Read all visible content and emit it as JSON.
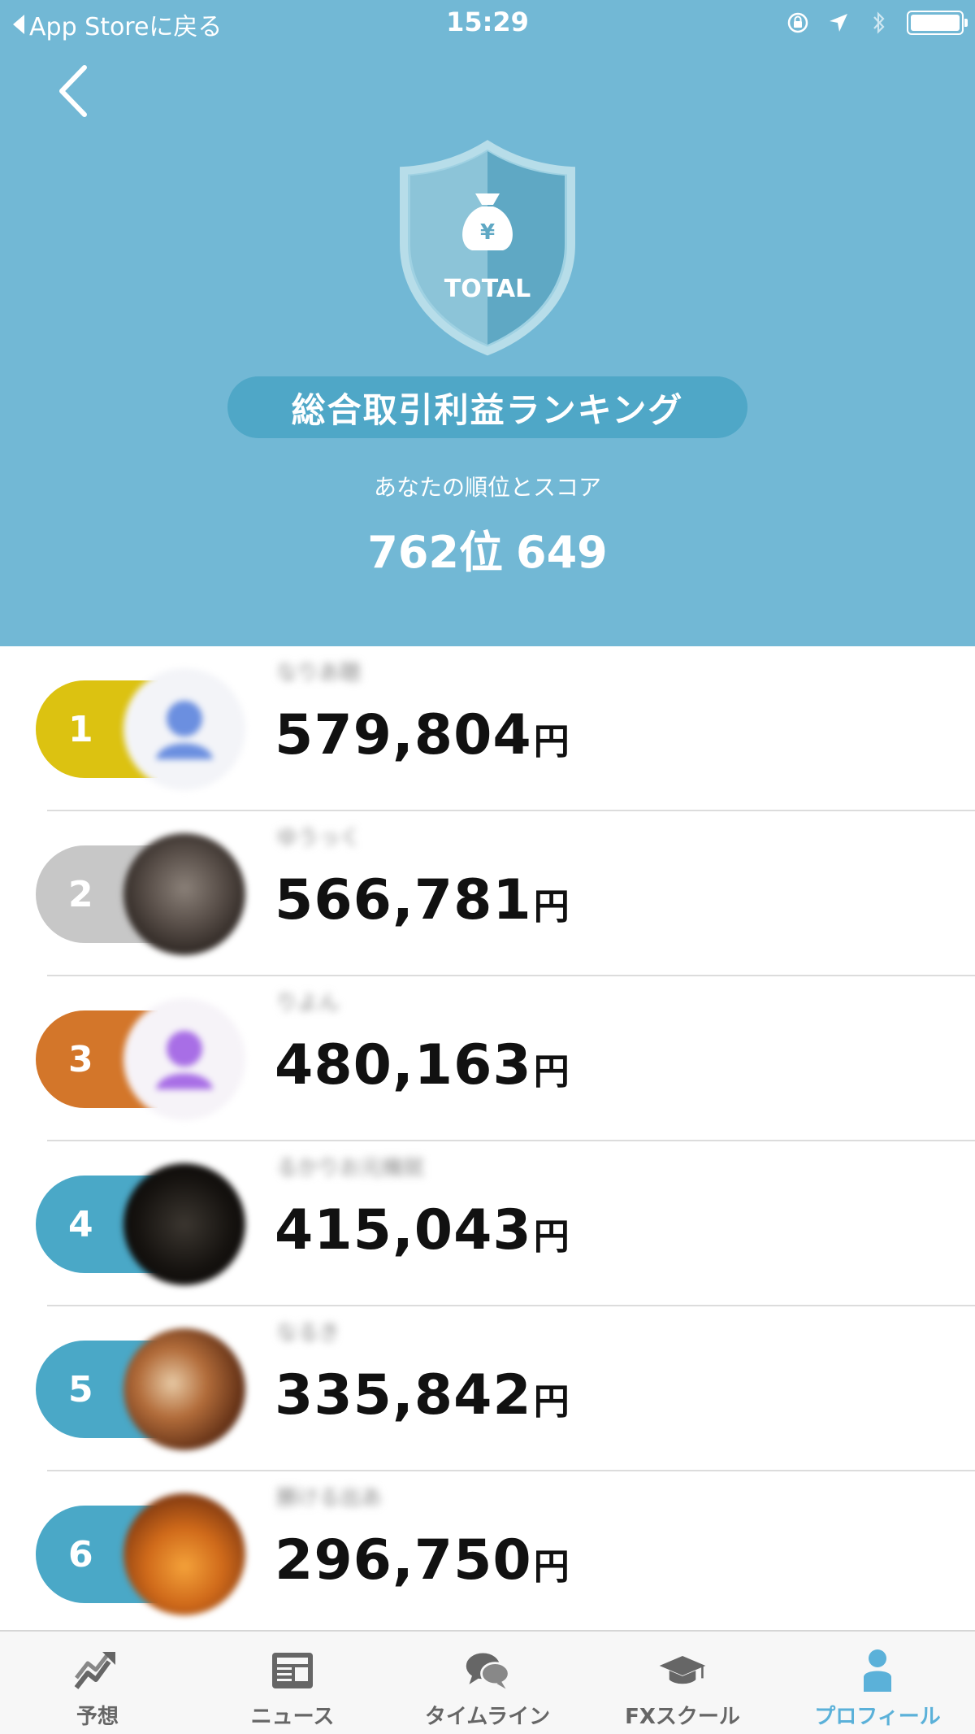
{
  "status_bar": {
    "back_app": "App Storeに戻る",
    "time": "15:29"
  },
  "header": {
    "badge_label": "TOTAL",
    "title": "総合取引利益ランキング",
    "your_label": "あなたの順位とスコア",
    "your_rank": "762位",
    "your_score": "649"
  },
  "colors": {
    "header_bg": "#72b8d5",
    "pill_bg": "#4fa7c7",
    "gold": "#dcc211",
    "silver": "#c7c7c7",
    "bronze": "#d3762a",
    "blue": "#4aa8c7",
    "active_tab": "#5bb1d9"
  },
  "ranking": [
    {
      "rank": "1",
      "username": "なりあ聴",
      "amount": "579,804",
      "unit": "円",
      "badge": "gold",
      "avatar": "user-placeholder-blue"
    },
    {
      "rank": "2",
      "username": "ゆうっく",
      "amount": "566,781",
      "unit": "円",
      "badge": "silver",
      "avatar": "photo-dark"
    },
    {
      "rank": "3",
      "username": "りよん",
      "amount": "480,163",
      "unit": "円",
      "badge": "bronze",
      "avatar": "user-placeholder-purple"
    },
    {
      "rank": "4",
      "username": "るかりお元機就",
      "amount": "415,043",
      "unit": "円",
      "badge": "blue",
      "avatar": "photo-black"
    },
    {
      "rank": "5",
      "username": "なるき",
      "amount": "335,842",
      "unit": "円",
      "badge": "blue",
      "avatar": "photo-brown"
    },
    {
      "rank": "6",
      "username": "勝ける出あ",
      "amount": "296,750",
      "unit": "円",
      "badge": "blue",
      "avatar": "photo-orange"
    }
  ],
  "tabs": [
    {
      "label": "予想",
      "icon": "trend-chart-icon",
      "active": false
    },
    {
      "label": "ニュース",
      "icon": "newspaper-icon",
      "active": false
    },
    {
      "label": "タイムライン",
      "icon": "chat-bubbles-icon",
      "active": false
    },
    {
      "label": "FXスクール",
      "icon": "graduation-cap-icon",
      "active": false
    },
    {
      "label": "プロフィール",
      "icon": "person-icon",
      "active": true
    }
  ]
}
